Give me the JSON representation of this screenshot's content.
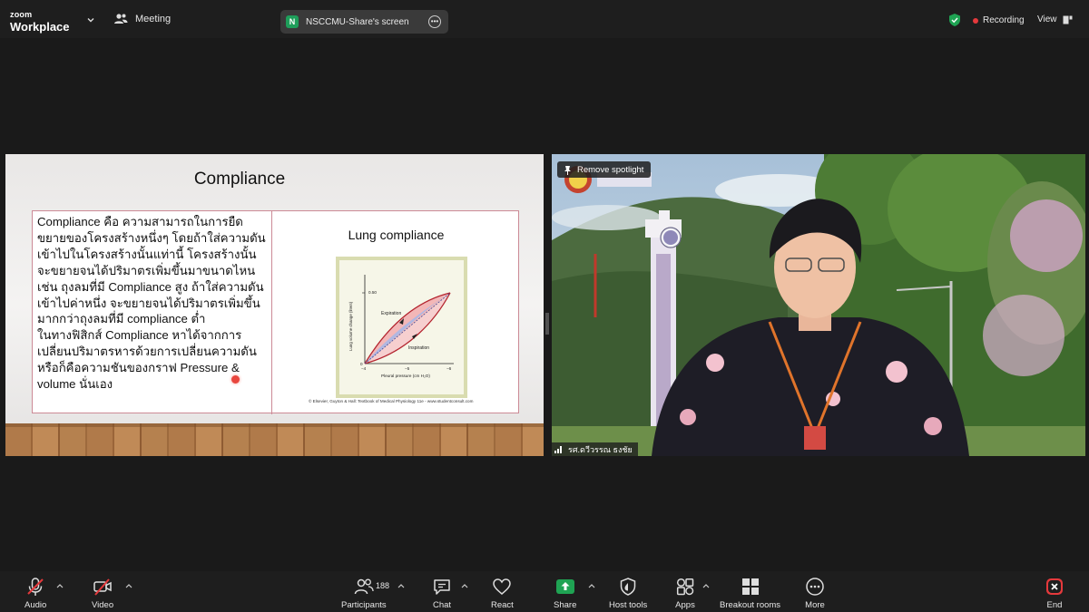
{
  "app": {
    "logo_line1": "zoom",
    "logo_line2": "Workplace",
    "meeting_label": "Meeting",
    "share_badge": "N",
    "share_label": "NSCCMU-Share's screen",
    "recording_label": "Recording",
    "view_label": "View"
  },
  "slide": {
    "title": "Compliance",
    "body": "Compliance คือ ความสามารถในการยืดขยายของโครงสร้างหนึ่งๆ โดยถ้าใส่ความดันเข้าไปในโครงสร้างนั้นแท่านี้ โครงสร้างนั้นจะขยายจนได้ปริมาตรเพิ่มขึ้นมาขนาดไหน เช่น ถุงลมที่มี Compliance สูง ถ้าใส่ความดันเข้าไปค่าหนึ่ง จะขยายจนได้ปริมาตรเพิ่มขึ้น มากกว่าถุงลมที่มี compliance ต่ำ\nในทางฟิสิกส์ Compliance หาได้จากการเปลี่ยนปริมาตรหารด้วยการเปลี่ยนความดัน หรือก็คือความชันของกราฟ Pressure & volume นั่นเอง",
    "figure_title": "Lung compliance",
    "figure_ylabel": "Lung volume change (liters)",
    "figure_xlabel": "Pleural pressure (cm H₂O)",
    "figure_ytick": "0.50",
    "figure_yzero": "0",
    "figure_xticks": [
      "−4",
      "−5",
      "−6"
    ],
    "figure_expiration": "Expiration",
    "figure_inspiration": "Inspiration",
    "figure_caption": "© Elsevier, Guyton & Hall: Textbook of Medical Physiology 11e - www.studentconsult.com"
  },
  "video": {
    "spotlight_label": "Remove spotlight",
    "participant_name": "รศ.ดวีวรรณ ธงชัย"
  },
  "toolbar": {
    "audio": "Audio",
    "video": "Video",
    "participants": "Participants",
    "participants_count": "188",
    "chat": "Chat",
    "react": "React",
    "share": "Share",
    "host_tools": "Host tools",
    "apps": "Apps",
    "breakout": "Breakout rooms",
    "more": "More",
    "end": "End"
  },
  "colors": {
    "share_green": "#1fa353",
    "end_red": "#e5393c",
    "recording_red": "#e5393c",
    "slide_border": "#cc8a96"
  }
}
